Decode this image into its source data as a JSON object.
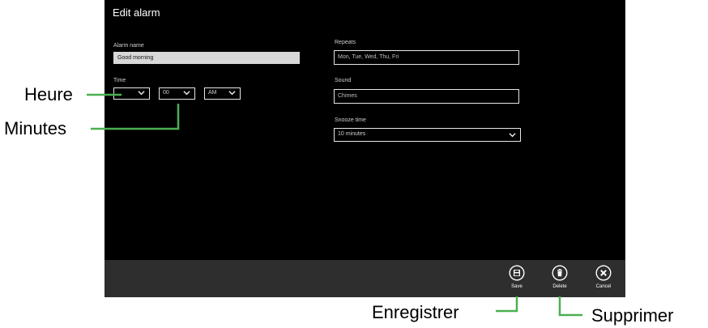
{
  "page": {
    "title": "Edit alarm"
  },
  "form": {
    "alarm_name": {
      "label": "Alarm name",
      "value": "Good morning"
    },
    "time": {
      "label": "Time",
      "hour": "",
      "minute": "00",
      "period": "AM"
    },
    "repeats": {
      "label": "Repeats",
      "value": "Mon, Tue, Wed, Thu, Fri"
    },
    "sound": {
      "label": "Sound",
      "value": "Chimes"
    },
    "snooze": {
      "label": "Snooze time",
      "value": "10 minutes"
    }
  },
  "app_bar": {
    "buttons": [
      {
        "label": "Save",
        "icon": "save-icon"
      },
      {
        "label": "Delete",
        "icon": "trash-icon"
      },
      {
        "label": "Cancel",
        "icon": "close-icon"
      }
    ]
  },
  "callouts": {
    "hour": "Heure",
    "minutes": "Minutes",
    "save": "Enregistrer",
    "delete": "Supprimer"
  },
  "colors": {
    "screen_bg": "#000000",
    "app_bar_bg": "#2e2e2e",
    "callout_line": "#4caf50"
  }
}
